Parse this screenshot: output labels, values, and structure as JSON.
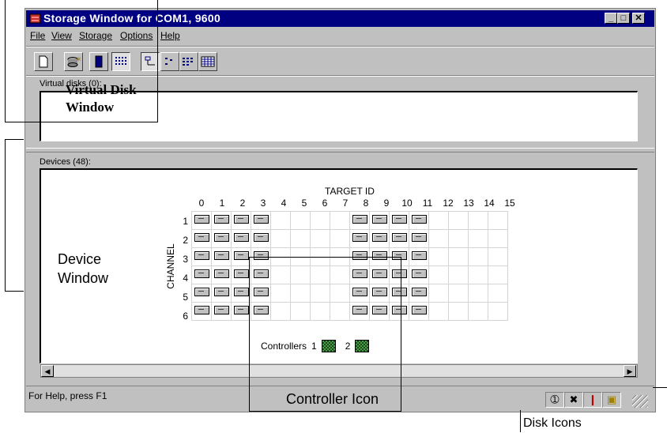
{
  "window": {
    "title": "Storage Window for COM1, 9600",
    "minimize": "_",
    "maximize": "□",
    "close": "✕"
  },
  "menu": [
    "File",
    "View",
    "Storage",
    "Options",
    "Help"
  ],
  "virtual_disks": {
    "label": "Virtual disks (0):"
  },
  "devices": {
    "label": "Devices (48):",
    "target_id_label": "TARGET ID",
    "channel_label": "CHANNEL",
    "columns": [
      "0",
      "1",
      "2",
      "3",
      "4",
      "5",
      "6",
      "7",
      "8",
      "9",
      "10",
      "11",
      "12",
      "13",
      "14",
      "15"
    ],
    "rows": [
      "1",
      "2",
      "3",
      "4",
      "5",
      "6"
    ],
    "populated_columns": [
      0,
      1,
      2,
      3,
      8,
      9,
      10,
      11
    ],
    "controllers_label": "Controllers",
    "controllers": [
      "1",
      "2"
    ]
  },
  "status_bar": {
    "text": "For Help, press F1"
  },
  "annotations": {
    "virtual_disk_window": [
      "Virtual Disk",
      "Window"
    ],
    "device_window": [
      "Device",
      "Window"
    ],
    "controller_icon": "Controller Icon",
    "disk_icons": "Disk Icons"
  },
  "icons": {
    "title": "storage-app-icon",
    "toolbar": [
      "new-document-icon",
      "disk-add-icon",
      "device-icon",
      "grid-view-icon",
      "tree-view-icon",
      "list-view-icon",
      "detail-view-icon",
      "table-view-icon"
    ],
    "status": [
      "circled-one-icon",
      "tools-icon",
      "thermometer-icon",
      "battery-icon"
    ]
  }
}
